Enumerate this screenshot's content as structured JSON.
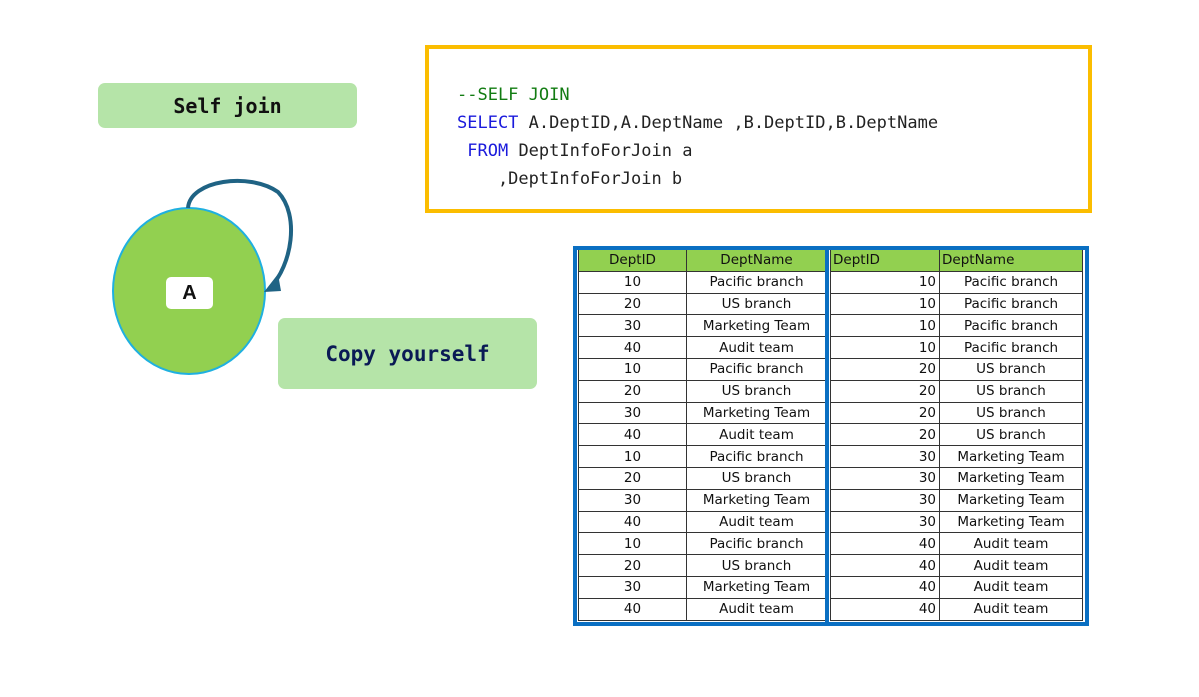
{
  "labels": {
    "self_join": "Self join",
    "copy_yourself": "Copy yourself",
    "node": "A"
  },
  "colors": {
    "label_bg": "#b5e4a8",
    "circle_fill": "#92d050",
    "circle_stroke": "#1fb0e0",
    "arrow": "#1f6384",
    "code_border": "#fbbd00",
    "table_frame": "#0a6fc2",
    "table_header": "#92d050"
  },
  "code": {
    "line1_comment": "--SELF JOIN",
    "line2_kw": "SELECT",
    "line2_rest": " A.DeptID,A.DeptName ,B.DeptID,B.DeptName",
    "line3_kw": "FROM",
    "line3_rest": " DeptInfoForJoin a",
    "line4": "    ,DeptInfoForJoin b"
  },
  "table": {
    "headers": [
      "DeptID",
      "DeptName",
      "DeptID",
      "DeptName"
    ],
    "rows": [
      [
        "10",
        "Pacific branch",
        "10",
        "Pacific branch"
      ],
      [
        "20",
        "US branch",
        "10",
        "Pacific branch"
      ],
      [
        "30",
        "Marketing Team",
        "10",
        "Pacific branch"
      ],
      [
        "40",
        "Audit team",
        "10",
        "Pacific branch"
      ],
      [
        "10",
        "Pacific branch",
        "20",
        "US branch"
      ],
      [
        "20",
        "US branch",
        "20",
        "US branch"
      ],
      [
        "30",
        "Marketing Team",
        "20",
        "US branch"
      ],
      [
        "40",
        "Audit team",
        "20",
        "US branch"
      ],
      [
        "10",
        "Pacific branch",
        "30",
        "Marketing Team"
      ],
      [
        "20",
        "US branch",
        "30",
        "Marketing Team"
      ],
      [
        "30",
        "Marketing Team",
        "30",
        "Marketing Team"
      ],
      [
        "40",
        "Audit team",
        "30",
        "Marketing Team"
      ],
      [
        "10",
        "Pacific branch",
        "40",
        "Audit team"
      ],
      [
        "20",
        "US branch",
        "40",
        "Audit team"
      ],
      [
        "30",
        "Marketing Team",
        "40",
        "Audit team"
      ],
      [
        "40",
        "Audit team",
        "40",
        "Audit team"
      ]
    ]
  }
}
